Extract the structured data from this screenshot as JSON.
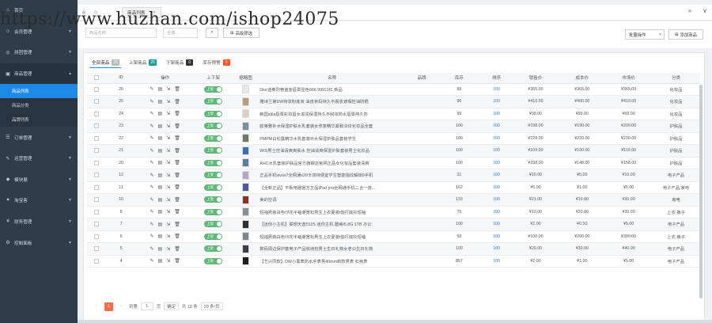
{
  "watermark": "https://www.huzhan.com/ishop24075",
  "sidebar": {
    "items": [
      {
        "label": "首页",
        "icon": "home-icon",
        "glyph": "⌂",
        "arrow": ""
      },
      {
        "label": "会员管理",
        "icon": "user-icon",
        "glyph": "☺",
        "arrow": "▼"
      },
      {
        "label": "拼团管理",
        "icon": "group-icon",
        "glyph": "◎",
        "arrow": "▼"
      },
      {
        "label": "商品管理",
        "icon": "goods-icon",
        "glyph": "▣",
        "arrow": "▲",
        "open": true
      }
    ],
    "subitems": [
      {
        "label": "商品列表",
        "active": true
      },
      {
        "label": "商品分类",
        "active": false
      },
      {
        "label": "品牌列表",
        "active": false
      }
    ],
    "items2": [
      {
        "label": "订单管理",
        "icon": "order-icon",
        "glyph": "☰",
        "arrow": "▼"
      },
      {
        "label": "运营管理",
        "icon": "operation-icon",
        "glyph": "✎",
        "arrow": "▼"
      },
      {
        "label": "模块展",
        "icon": "module-icon",
        "glyph": "◆",
        "arrow": "▼"
      },
      {
        "label": "淘宝客",
        "icon": "taobao-icon",
        "glyph": "♥",
        "arrow": "▼"
      },
      {
        "label": "财务管理",
        "icon": "finance-icon",
        "glyph": "¥",
        "arrow": "▼"
      },
      {
        "label": "控制面板",
        "icon": "panel-icon",
        "glyph": "⚙",
        "arrow": "▼"
      }
    ]
  },
  "tabbar": {
    "tab_label": "商品列表",
    "close": "×",
    "left": "«",
    "right": "»",
    "menu": "∨"
  },
  "toolbar": {
    "search_placeholder": "商品名称",
    "select_placeholder": "全部",
    "search_glyph": "⌕",
    "filter_label": "高级筛选",
    "batch_label": "批量操作",
    "add_label": "添加商品"
  },
  "filters": [
    {
      "label": "全部商品",
      "count": "25",
      "color": "#bbbbbb",
      "active": true
    },
    {
      "label": "上架商品",
      "count": "25",
      "color": "#1aa094",
      "active": false
    },
    {
      "label": "下架商品",
      "count": "0",
      "color": "#333333",
      "active": false
    },
    {
      "label": "库存预警",
      "count": "0",
      "color": "#ff5722",
      "active": false
    }
  ],
  "table": {
    "headers": [
      "",
      "ID",
      "操作",
      "上下架",
      "缩略图",
      "名称",
      "品牌",
      "库存",
      "排序",
      "销售价",
      "成本价",
      "市场价",
      "分类"
    ],
    "switch_label": "上架",
    "ops": [
      "✎",
      "▤",
      "⇲",
      "🗑"
    ],
    "rows": [
      {
        "id": "26",
        "name": "Dior迪奥烈艳蓝金唇膏显色666 999口红 新品",
        "brand": "",
        "stock": "89",
        "sort": "100",
        "price": "¥365.00",
        "cost": "¥365.00",
        "market": "¥365.00",
        "cat": "化妆品",
        "thumb": "#e9e6e3"
      },
      {
        "id": "25",
        "name": "雅诗兰黛DW持妆粉底液 油皮亲妈持久不脱妆遮瑕控油防晒",
        "brand": "",
        "stock": "96",
        "sort": "100",
        "price": "¥410.00",
        "cost": "¥400.00",
        "market": "¥410.00",
        "cat": "化妆品",
        "thumb": "#b89a7e"
      },
      {
        "id": "24",
        "name": "韩国stila唇膏彩妆唇女滋润保湿持久不脱妆防水唇膏持久防",
        "brand": "",
        "stock": "99",
        "sort": "100",
        "price": "¥99.00",
        "cost": "¥99.00",
        "market": "¥99.00",
        "cat": "化妆品",
        "thumb": "#d9cfc8"
      },
      {
        "id": "23",
        "name": "欧莱雅补水保湿护肤水乳套装女修复精华紧致淡纹化妆品全套",
        "brand": "",
        "stock": "100",
        "sort": "100",
        "price": "¥198.00",
        "cost": "¥190.00",
        "market": "¥200.00",
        "cat": "护肤品",
        "thumb": "#7a8f9e"
      },
      {
        "id": "22",
        "name": "PMPM白松露精华水乳套装补水保湿护肤品套装学生",
        "brand": "",
        "stock": "100",
        "sort": "100",
        "price": "¥229.00",
        "cost": "¥220.00",
        "market": "¥230.00",
        "cat": "护肤品",
        "thumb": "#6b7a60"
      },
      {
        "id": "21",
        "name": "WIS男士控油清爽爽肤水 控油清爽保湿护肤套装男士化妆品",
        "brand": "",
        "stock": "100",
        "sort": "100",
        "price": "¥109.00",
        "cost": "¥100.00",
        "market": "¥110.00",
        "cat": "护肤品",
        "thumb": "#3d6fb0"
      },
      {
        "id": "20",
        "name": "AHC水乳套装护肤品官方旗舰店官网正品女化妆品套装清爽",
        "brand": "",
        "stock": "100",
        "sort": "100",
        "price": "¥158.00",
        "cost": "¥148.00",
        "market": "¥158.00",
        "cat": "护肤品",
        "thumb": "#5a7fa5"
      },
      {
        "id": "12",
        "name": "正品手机vivox7全网通x20卡双待便宜学生智能指纹解锁9手机",
        "brand": "",
        "stock": "31",
        "sort": "100",
        "price": "¥10.00",
        "cost": "¥5.00",
        "market": "¥10.00",
        "cat": "电子产品",
        "thumb": "#b8a4c9"
      },
      {
        "id": "11",
        "name": "【全新正品】平板电脑官方正品iPad pro全网通手机二合一游...",
        "brand": "",
        "stock": "162",
        "sort": "100",
        "price": "¥5.00",
        "cost": "¥1.00",
        "market": "¥5.00",
        "cat": "电子产品,家电",
        "thumb": "#4a5a9a"
      },
      {
        "id": "10",
        "name": "美的空调",
        "brand": "",
        "stock": "133",
        "sort": "100",
        "price": "¥21.00",
        "cost": "¥10.00",
        "market": "¥30.00",
        "cat": "家电",
        "thumb": "#9a2a2a"
      },
      {
        "id": "8",
        "name": "短袖男装白色印花半袖潮宽松男生上衣夏装t恤打底衫短袖",
        "brand": "",
        "stock": "75",
        "sort": "100",
        "price": "¥10.00",
        "cost": "¥20.00",
        "market": "¥30.00",
        "cat": "上衣,裤子",
        "thumb": "#8a8f96"
      },
      {
        "id": "7",
        "name": "【迷你小主机】联想天逸510S 迷你主机 酷睿i5 8G 1TB 办公",
        "brand": "",
        "stock": "100",
        "sort": "100",
        "price": "¥2.00",
        "cost": "¥0.50",
        "market": "¥5.00",
        "cat": "电子产品",
        "thumb": "#2e2e2e"
      },
      {
        "id": "6",
        "name": "短袖男装白色印花半袖潮宽松男生上衣夏装t恤打底衫短袖",
        "brand": "",
        "stock": "68",
        "sort": "100",
        "price": "¥100.00",
        "cost": "¥200.00",
        "market": "¥300.00",
        "cat": "上衣,裤子",
        "thumb": "#7c848c"
      },
      {
        "id": "5",
        "name": "数码周边保护套电子产品收纳包男士生日礼物女老公生日礼物",
        "brand": "",
        "stock": "100",
        "sort": "100",
        "price": "¥20.00",
        "cost": "¥30.00",
        "market": "¥40.00",
        "cat": "电子产品",
        "thumb": "#3c3c48"
      },
      {
        "id": "4",
        "name": "【艺兴同款】DW小黑表防水手表男40mm新款男表 石英表",
        "brand": "",
        "stock": "857",
        "sort": "100",
        "price": "¥2.00",
        "cost": "¥1.00",
        "market": "¥5.00",
        "cat": "电子产品",
        "thumb": "#1e1e1e"
      }
    ]
  },
  "pager": {
    "prev": "‹",
    "current": "1",
    "next": "›",
    "goto_label": "到第",
    "page_value": "1",
    "page_unit": "页",
    "confirm": "确定",
    "total": "共 18 条",
    "per_page": "20 条/页"
  }
}
